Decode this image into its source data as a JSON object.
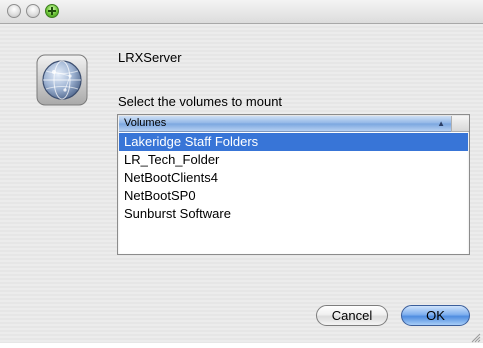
{
  "window": {
    "title": ""
  },
  "titlebar": {
    "close_icon": "close-icon",
    "minimize_icon": "minimize-icon",
    "zoom_icon": "zoom-icon"
  },
  "dialog": {
    "icon": "network-globe-icon",
    "server_name": "LRXServer",
    "prompt": "Select the volumes to mount",
    "list": {
      "column_header": "Volumes",
      "sort_icon": "sort-ascending-icon",
      "sort_glyph": "▲",
      "items": [
        {
          "label": "Lakeridge Staff Folders",
          "selected": true
        },
        {
          "label": "LR_Tech_Folder",
          "selected": false
        },
        {
          "label": "NetBootClients4",
          "selected": false
        },
        {
          "label": "NetBootSP0",
          "selected": false
        },
        {
          "label": "Sunburst Software",
          "selected": false
        }
      ]
    },
    "buttons": {
      "cancel_label": "Cancel",
      "ok_label": "OK"
    }
  },
  "colors": {
    "selection": "#3875d7",
    "default_button": "#4f8de0"
  }
}
